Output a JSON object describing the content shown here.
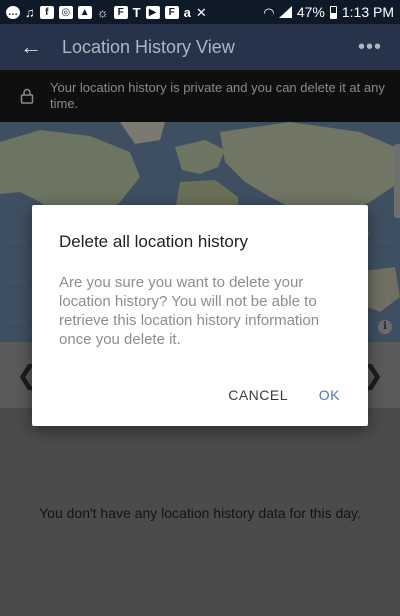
{
  "status_bar": {
    "battery": "47%",
    "time": "1:13 PM",
    "icons": [
      "chat-bubble-icon",
      "music-note-icon",
      "facebook-icon",
      "instagram-icon",
      "image-icon",
      "weather-icon",
      "flipboard-icon",
      "t-mobile-icon",
      "youtube-icon",
      "flipboard-icon",
      "amazon-icon",
      "mute-icon",
      "wifi-icon",
      "signal-icon",
      "battery-icon"
    ]
  },
  "app_bar": {
    "title": "Location History View",
    "back_icon": "back-arrow-icon",
    "more_icon": "more-dots-icon"
  },
  "banner": {
    "text": "Your location history is private and you can delete it at any time.",
    "icon": "lock-icon"
  },
  "dialog": {
    "title": "Delete all location history",
    "body": "Are you sure you want to delete your location history? You will not be able to retrieve this location history information once you delete it.",
    "cancel_label": "CANCEL",
    "ok_label": "OK"
  },
  "empty_message": "You don't have any location history data for this day.",
  "colors": {
    "app_bar": "#27334a",
    "status_bar": "#0f1a29",
    "dialog_ok": "#4a78b8",
    "scrim_background": "#4b4b4b"
  }
}
